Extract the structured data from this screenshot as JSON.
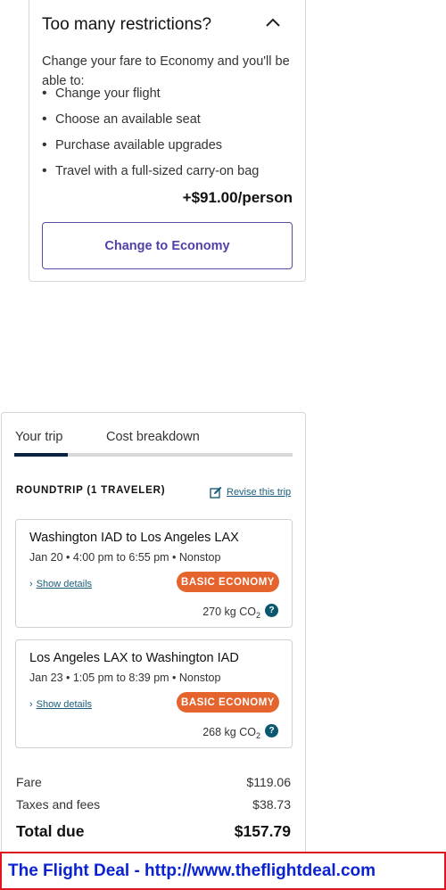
{
  "restrictions": {
    "title": "Too many restrictions?",
    "description": "Change your fare to Economy and you'll be able to:",
    "benefits": [
      "Change your flight",
      "Choose an available seat",
      "Purchase available upgrades",
      "Travel with a full-sized carry-on bag"
    ],
    "price": "+$91.00/person",
    "button_label": "Change to Economy"
  },
  "trip": {
    "tabs": [
      "Your trip",
      "Cost breakdown"
    ],
    "active_tab": "Your trip",
    "header": "ROUNDTRIP (1 TRAVELER)",
    "revise_label": "Revise this trip",
    "flights": [
      {
        "route": "Washington IAD to Los Angeles LAX",
        "schedule": "Jan 20 • 4:00 pm to 6:55 pm • Nonstop",
        "details_label": "Show details",
        "badge": "BASIC ECONOMY",
        "co2": "270 kg CO",
        "co2_sub": "2"
      },
      {
        "route": "Los Angeles LAX to Washington IAD",
        "schedule": "Jan 23 • 1:05 pm to 8:39 pm • Nonstop",
        "details_label": "Show details",
        "badge": "BASIC ECONOMY",
        "co2": "268 kg CO",
        "co2_sub": "2"
      }
    ],
    "costs": [
      {
        "label": "Fare",
        "value": "$119.06"
      },
      {
        "label": "Taxes and fees",
        "value": "$38.73"
      }
    ],
    "total_label": "Total due",
    "total_value": "$157.79"
  },
  "watermark": "The Flight Deal - http://www.theflightdeal.com",
  "colors": {
    "accent_purple": "#5340a7",
    "badge_orange": "#e5632c",
    "link_teal": "#1a5d7a",
    "tab_active": "#0a2340",
    "watermark_border": "#e0161f",
    "watermark_text": "#0a22d0"
  }
}
